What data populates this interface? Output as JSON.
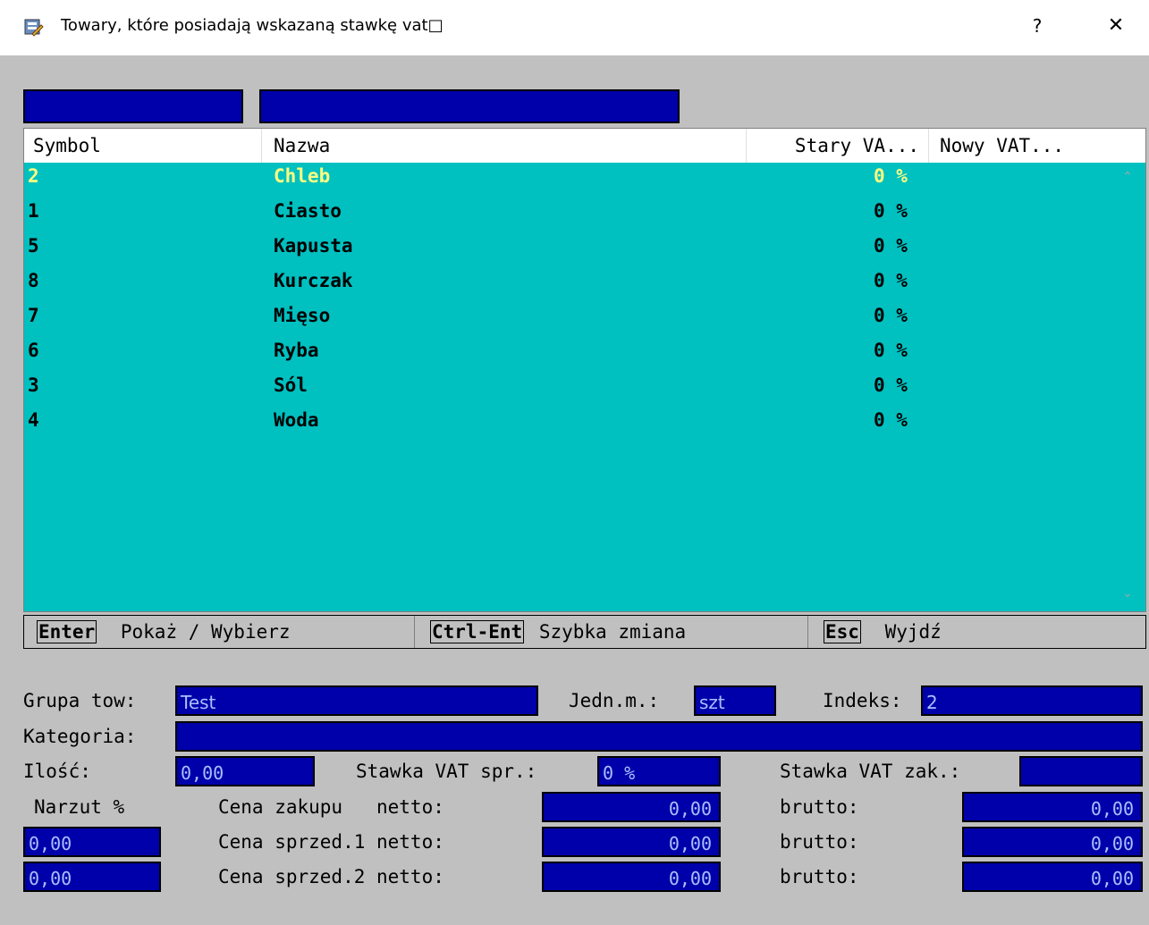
{
  "window": {
    "title": "Towary, które posiadają wskazaną stawkę vat□",
    "help": "?",
    "close": "✕"
  },
  "grid": {
    "columns": [
      "Symbol",
      "Nazwa",
      "Stary VA...",
      "Nowy VAT..."
    ],
    "rows": [
      {
        "symbol": "2",
        "nazwa": "Chleb",
        "stary": "0 %"
      },
      {
        "symbol": "1",
        "nazwa": "Ciasto",
        "stary": "0 %"
      },
      {
        "symbol": "5",
        "nazwa": "Kapusta",
        "stary": "0 %"
      },
      {
        "symbol": "8",
        "nazwa": "Kurczak",
        "stary": "0 %"
      },
      {
        "symbol": "7",
        "nazwa": "Mięso",
        "stary": "0 %"
      },
      {
        "symbol": "6",
        "nazwa": "Ryba",
        "stary": "0 %"
      },
      {
        "symbol": "3",
        "nazwa": "Sól",
        "stary": "0 %"
      },
      {
        "symbol": "4",
        "nazwa": "Woda",
        "stary": "0 %"
      }
    ]
  },
  "hotkeys": [
    {
      "key": "Enter",
      "label": "Pokaż / Wybierz"
    },
    {
      "key": "Ctrl-Ent",
      "label": "Szybka zmiana"
    },
    {
      "key": "Esc",
      "label": "Wyjdź"
    }
  ],
  "details": {
    "grupa_label": "Grupa tow:",
    "grupa_value": "Test",
    "jedn_label": "Jedn.m.:",
    "jedn_value": "szt",
    "indeks_label": "Indeks:",
    "indeks_value": "2",
    "kategoria_label": "Kategoria:",
    "kategoria_value": "",
    "ilosc_label": "Ilość:",
    "ilosc_value": "0,00",
    "vat_spr_label": "Stawka VAT spr.:",
    "vat_spr_value": "0 %",
    "vat_zak_label": "Stawka VAT zak.:",
    "vat_zak_value": "",
    "narzut_label": "Narzut %",
    "narzut1_value": "0,00",
    "narzut2_value": "0,00",
    "cena_zak_label": "Cena zakupu   netto:",
    "cena_zak_netto": "0,00",
    "cena_spr1_label": "Cena sprzed.1 netto:",
    "cena_spr1_netto": "0,00",
    "cena_spr2_label": "Cena sprzed.2 netto:",
    "cena_spr2_netto": "0,00",
    "brutto_label": "brutto:",
    "cena_zak_brutto": "0,00",
    "cena_spr1_brutto": "0,00",
    "cena_spr2_brutto": "0,00"
  }
}
